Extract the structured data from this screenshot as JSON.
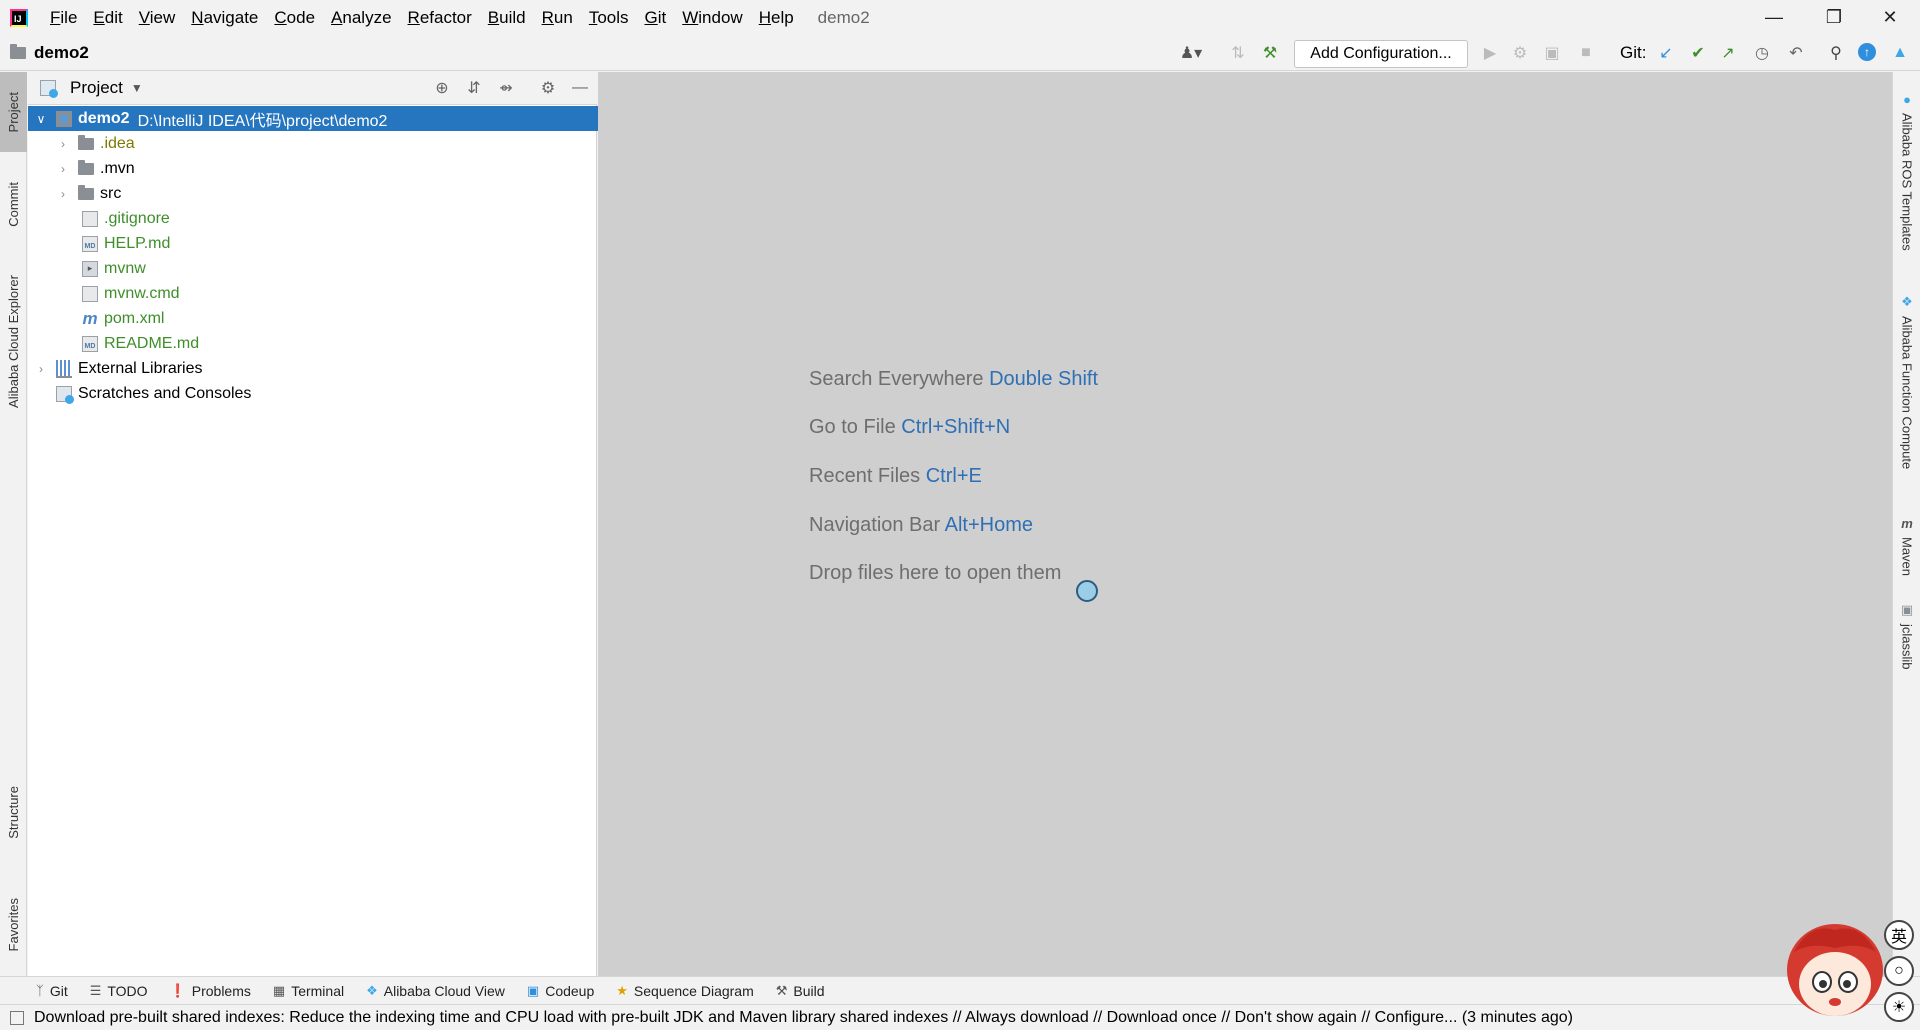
{
  "window": {
    "project_title": "demo2",
    "menu": [
      "File",
      "Edit",
      "View",
      "Navigate",
      "Code",
      "Analyze",
      "Refactor",
      "Build",
      "Run",
      "Tools",
      "Git",
      "Window",
      "Help"
    ]
  },
  "toolbar": {
    "breadcrumb": "demo2",
    "add_configuration": "Add Configuration...",
    "git_label": "Git:"
  },
  "left_tabs": [
    "Project",
    "Commit",
    "Alibaba Cloud Explorer",
    "Structure",
    "Favorites"
  ],
  "project_panel": {
    "title": "Project",
    "root_name": "demo2",
    "root_path": "D:\\IntelliJ IDEA\\代码\\project\\demo2",
    "items": [
      ".idea",
      ".mvn",
      "src",
      ".gitignore",
      "HELP.md",
      "mvnw",
      "mvnw.cmd",
      "pom.xml",
      "README.md"
    ],
    "external_libraries": "External Libraries",
    "scratches": "Scratches and Consoles"
  },
  "editor_hints": [
    {
      "text": "Search Everywhere",
      "key": "Double Shift"
    },
    {
      "text": "Go to File",
      "key": "Ctrl+Shift+N"
    },
    {
      "text": "Recent Files",
      "key": "Ctrl+E"
    },
    {
      "text": "Navigation Bar",
      "key": "Alt+Home"
    },
    {
      "text": "Drop files here to open them",
      "key": ""
    }
  ],
  "right_tabs": [
    "Alibaba ROS Templates",
    "Alibaba Function Compute",
    "Maven",
    "jclasslib"
  ],
  "bottom_tabs": [
    "Git",
    "TODO",
    "Problems",
    "Terminal",
    "Alibaba Cloud View",
    "Codeup",
    "Sequence Diagram",
    "Build"
  ],
  "status": {
    "message": "Download pre-built shared indexes: Reduce the indexing time and CPU load with pre-built JDK and Maven library shared indexes // Always download // Download once // Don't show again // Configure... (3 minutes ago)"
  },
  "ime": {
    "lang": "英"
  },
  "colors": {
    "selection": "#2675bf",
    "hint_key": "#2f6fb5",
    "git_green": "#3e8e2a"
  }
}
